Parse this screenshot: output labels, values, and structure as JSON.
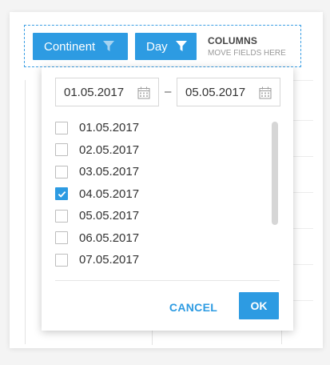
{
  "header": {
    "chips": [
      {
        "label": "Continent",
        "icon": "filter-icon"
      },
      {
        "label": "Day",
        "icon": "filter-icon"
      }
    ],
    "columns_title": "COLUMNS",
    "columns_hint": "MOVE FIELDS HERE"
  },
  "filter": {
    "date_from": "01.05.2017",
    "date_to": "05.05.2017",
    "range_separator": "–",
    "items": [
      {
        "label": "01.05.2017",
        "checked": false
      },
      {
        "label": "02.05.2017",
        "checked": false
      },
      {
        "label": "03.05.2017",
        "checked": false
      },
      {
        "label": "04.05.2017",
        "checked": true
      },
      {
        "label": "05.05.2017",
        "checked": false
      },
      {
        "label": "06.05.2017",
        "checked": false
      },
      {
        "label": "07.05.2017",
        "checked": false
      }
    ],
    "cancel_label": "CANCEL",
    "ok_label": "OK"
  },
  "colors": {
    "accent": "#2d9be2",
    "background": "#f4f4f4"
  }
}
